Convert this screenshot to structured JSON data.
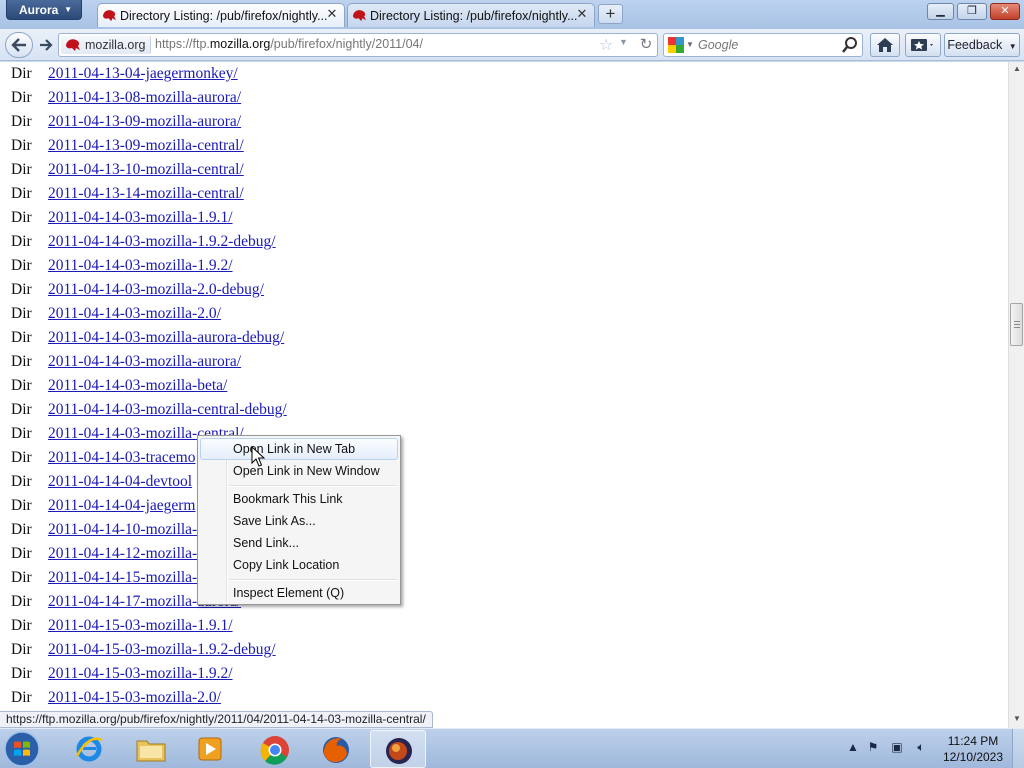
{
  "browser": {
    "app_menu_label": "Aurora",
    "tabs": [
      {
        "title": "Directory Listing: /pub/firefox/nightly...",
        "active": true
      },
      {
        "title": "Directory Listing: /pub/firefox/nightly...",
        "active": false
      }
    ],
    "new_tab_label": "+",
    "identity_label": "mozilla.org",
    "url_prefix": "https://ftp.",
    "url_domain": "mozilla.org",
    "url_path": "/pub/firefox/nightly/2011/04/",
    "search_placeholder": "Google",
    "feedback_label": "Feedback"
  },
  "listing": [
    {
      "type": "Dir",
      "name": "2011-04-13-04-jaegermonkey/"
    },
    {
      "type": "Dir",
      "name": "2011-04-13-08-mozilla-aurora/"
    },
    {
      "type": "Dir",
      "name": "2011-04-13-09-mozilla-aurora/"
    },
    {
      "type": "Dir",
      "name": "2011-04-13-09-mozilla-central/"
    },
    {
      "type": "Dir",
      "name": "2011-04-13-10-mozilla-central/"
    },
    {
      "type": "Dir",
      "name": "2011-04-13-14-mozilla-central/"
    },
    {
      "type": "Dir",
      "name": "2011-04-14-03-mozilla-1.9.1/"
    },
    {
      "type": "Dir",
      "name": "2011-04-14-03-mozilla-1.9.2-debug/"
    },
    {
      "type": "Dir",
      "name": "2011-04-14-03-mozilla-1.9.2/"
    },
    {
      "type": "Dir",
      "name": "2011-04-14-03-mozilla-2.0-debug/"
    },
    {
      "type": "Dir",
      "name": "2011-04-14-03-mozilla-2.0/"
    },
    {
      "type": "Dir",
      "name": "2011-04-14-03-mozilla-aurora-debug/"
    },
    {
      "type": "Dir",
      "name": "2011-04-14-03-mozilla-aurora/"
    },
    {
      "type": "Dir",
      "name": "2011-04-14-03-mozilla-beta/"
    },
    {
      "type": "Dir",
      "name": "2011-04-14-03-mozilla-central-debug/"
    },
    {
      "type": "Dir",
      "name": "2011-04-14-03-mozilla-central/"
    },
    {
      "type": "Dir",
      "name": "2011-04-14-03-tracemo"
    },
    {
      "type": "Dir",
      "name": "2011-04-14-04-devtool"
    },
    {
      "type": "Dir",
      "name": "2011-04-14-04-jaegerm"
    },
    {
      "type": "Dir",
      "name": "2011-04-14-10-mozilla-"
    },
    {
      "type": "Dir",
      "name": "2011-04-14-12-mozilla-"
    },
    {
      "type": "Dir",
      "name": "2011-04-14-15-mozilla-"
    },
    {
      "type": "Dir",
      "name": "2011-04-14-17-mozilla-aurora/"
    },
    {
      "type": "Dir",
      "name": "2011-04-15-03-mozilla-1.9.1/"
    },
    {
      "type": "Dir",
      "name": "2011-04-15-03-mozilla-1.9.2-debug/"
    },
    {
      "type": "Dir",
      "name": "2011-04-15-03-mozilla-1.9.2/"
    },
    {
      "type": "Dir",
      "name": "2011-04-15-03-mozilla-2.0/"
    }
  ],
  "context_menu": {
    "items": [
      {
        "label": "Open Link in New Tab",
        "highlighted": true
      },
      {
        "label": "Open Link in New Window",
        "highlighted": false
      },
      {
        "separator": true
      },
      {
        "label": "Bookmark This Link",
        "highlighted": false
      },
      {
        "label": "Save Link As...",
        "highlighted": false
      },
      {
        "label": "Send Link...",
        "highlighted": false
      },
      {
        "label": "Copy Link Location",
        "highlighted": false
      },
      {
        "separator": true
      },
      {
        "label": "Inspect Element (Q)",
        "highlighted": false
      }
    ]
  },
  "status_text": "https://ftp.mozilla.org/pub/firefox/nightly/2011/04/2011-04-14-03-mozilla-central/",
  "taskbar": {
    "apps": [
      "internet-explorer-icon",
      "windows-explorer-icon",
      "media-player-icon",
      "chrome-icon",
      "firefox-icon",
      "firefox-aurora-icon"
    ],
    "clock_time": "11:24 PM",
    "clock_date": "12/10/2023"
  },
  "colors": {
    "link": "#1a1ab4",
    "titlebar": "#bcd2ee",
    "taskbar": "#a9c1e1"
  }
}
